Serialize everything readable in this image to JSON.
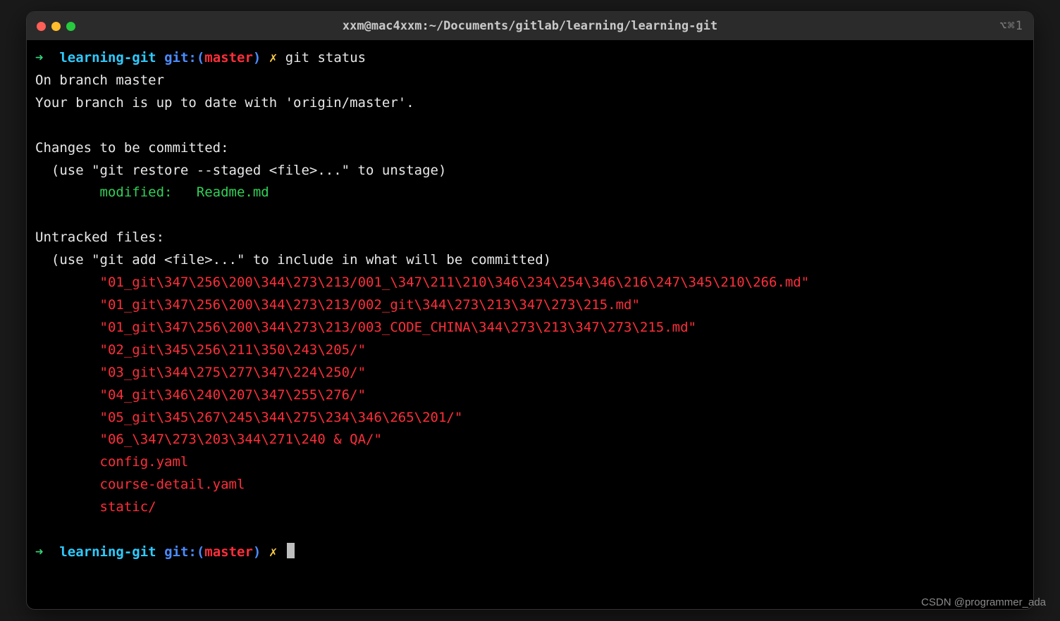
{
  "window": {
    "title": "xxm@mac4xxm:~/Documents/gitlab/learning/learning-git",
    "shortcut_indicator": "⌥⌘1"
  },
  "prompt": {
    "arrow": "➜",
    "dir": "learning-git",
    "git_label": "git:(",
    "branch": "master",
    "git_close": ")",
    "dirty_mark": "✗"
  },
  "command": "git status",
  "output": {
    "branch_line": "On branch master",
    "uptodate_line": "Your branch is up to date with 'origin/master'.",
    "staged_header": "Changes to be committed:",
    "staged_hint": "  (use \"git restore --staged <file>...\" to unstage)",
    "staged_entry_label": "modified:",
    "staged_entry_file": "Readme.md",
    "untracked_header": "Untracked files:",
    "untracked_hint": "  (use \"git add <file>...\" to include in what will be committed)",
    "untracked_files": [
      "\"01_git\\347\\256\\200\\344\\273\\213/001_\\347\\211\\210\\346\\234\\254\\346\\216\\247\\345\\210\\266.md\"",
      "\"01_git\\347\\256\\200\\344\\273\\213/002_git\\344\\273\\213\\347\\273\\215.md\"",
      "\"01_git\\347\\256\\200\\344\\273\\213/003_CODE_CHINA\\344\\273\\213\\347\\273\\215.md\"",
      "\"02_git\\345\\256\\211\\350\\243\\205/\"",
      "\"03_git\\344\\275\\277\\347\\224\\250/\"",
      "\"04_git\\346\\240\\207\\347\\255\\276/\"",
      "\"05_git\\345\\267\\245\\344\\275\\234\\346\\265\\201/\"",
      "\"06_\\347\\273\\203\\344\\271\\240 & QA/\"",
      "config.yaml",
      "course-detail.yaml",
      "static/"
    ]
  },
  "watermark": "CSDN @programmer_ada"
}
